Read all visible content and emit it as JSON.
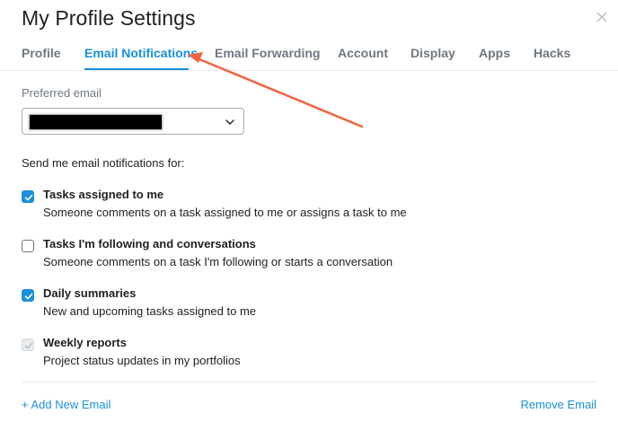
{
  "dialog": {
    "title": "My Profile Settings",
    "close_icon": "close-icon"
  },
  "tabs": [
    {
      "label": "Profile",
      "active": false
    },
    {
      "label": "Email Notifications",
      "active": true
    },
    {
      "label": "Email Forwarding",
      "active": false
    },
    {
      "label": "Account",
      "active": false
    },
    {
      "label": "Display",
      "active": false
    },
    {
      "label": "Apps",
      "active": false
    },
    {
      "label": "Hacks",
      "active": false
    }
  ],
  "preferred_email": {
    "label": "Preferred email",
    "value_redacted": true,
    "dropdown_icon": "chevron-down-icon"
  },
  "notifications": {
    "section_title": "Send me email notifications for:",
    "items": [
      {
        "title": "Tasks assigned to me",
        "description": "Someone comments on a task assigned to me or assigns a task to me",
        "state": "checked"
      },
      {
        "title": "Tasks I'm following and conversations",
        "description": "Someone comments on a task I'm following or starts a conversation",
        "state": "unchecked"
      },
      {
        "title": "Daily summaries",
        "description": "New and upcoming tasks assigned to me",
        "state": "checked"
      },
      {
        "title": "Weekly reports",
        "description": "Project status updates in my portfolios",
        "state": "disabled"
      }
    ]
  },
  "footer": {
    "add_email": "+ Add New Email",
    "remove_email": "Remove Email"
  },
  "colors": {
    "accent": "#1a8fdd",
    "annotation_arrow": "#f0643c",
    "text_muted": "#6f7782"
  }
}
